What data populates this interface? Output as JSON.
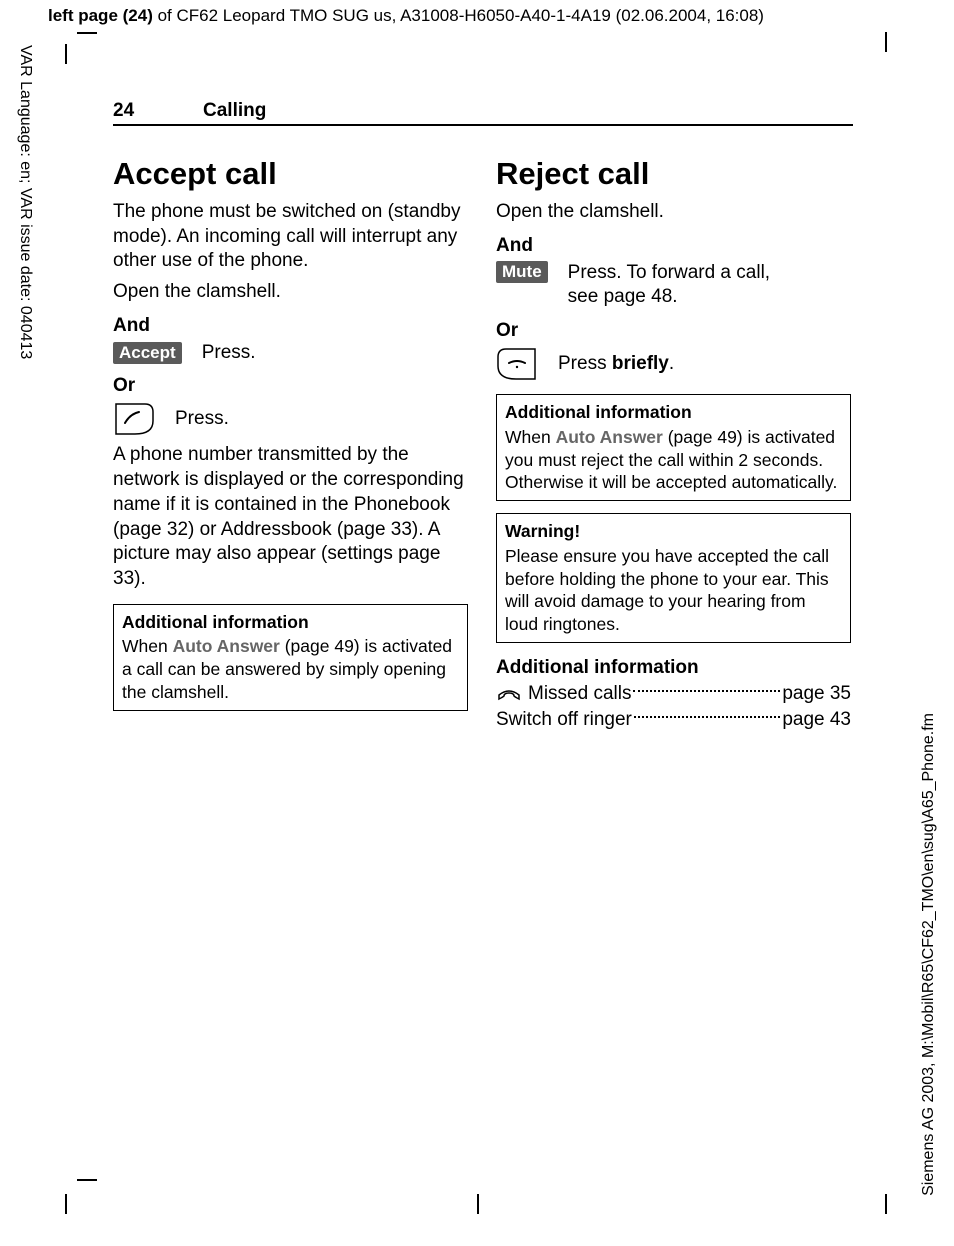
{
  "meta": {
    "top_header_bold": "left page (24)",
    "top_header_rest": " of CF62 Leopard TMO SUG us, A31008-H6050-A40-1-4A19 (02.06.2004, 16:08)",
    "vtext_left": "VAR Language: en; VAR issue date: 040413",
    "vtext_right": "Siemens AG 2003, M:\\Mobil\\R65\\CF62_TMO\\en\\sug\\A65_Phone.fm"
  },
  "runhead": {
    "page": "24",
    "section": "Calling"
  },
  "left": {
    "h1": "Accept call",
    "p1": "The phone must be switched on (standby mode). An incoming call will interrupt any other use of the phone.",
    "p2": "Open the clamshell.",
    "and": "And",
    "accept_label": "Accept",
    "accept_desc": "Press.",
    "or": "Or",
    "call_desc": "Press.",
    "p3": "A phone number transmitted by the network is displayed or the corresponding name if it is contained in the Phonebook (page 32) or Addressbook (page 33). A picture may also appear (settings page 33).",
    "box_head": "Additional information",
    "box_pre": "When ",
    "box_hl": "Auto Answer",
    "box_post": " (page 49) is activated a call can be answered by simply opening the clamshell."
  },
  "right": {
    "h1": "Reject call",
    "p1": "Open the clamshell.",
    "and": "And",
    "mute_label": "Mute",
    "mute_desc": "Press. To forward a call, see page 48.",
    "or": "Or",
    "end_desc_pre": "Press ",
    "end_desc_bold": "briefly",
    "end_desc_post": ".",
    "box1_head": "Additional information",
    "box1_pre": "When ",
    "box1_hl": "Auto Answer",
    "box1_post": " (page 49) is activated you must reject the call within 2 seconds. Otherwise it will be accepted automatically.",
    "box2_head": "Warning!",
    "box2_body": "Please ensure you have accepted the call before holding the phone to your ear. This will avoid damage to your hearing from loud ringtones.",
    "addl": "Additional information",
    "row1_label": "Missed calls",
    "row1_page": "page 35",
    "row2_label": "Switch off ringer",
    "row2_page": "page 43"
  }
}
